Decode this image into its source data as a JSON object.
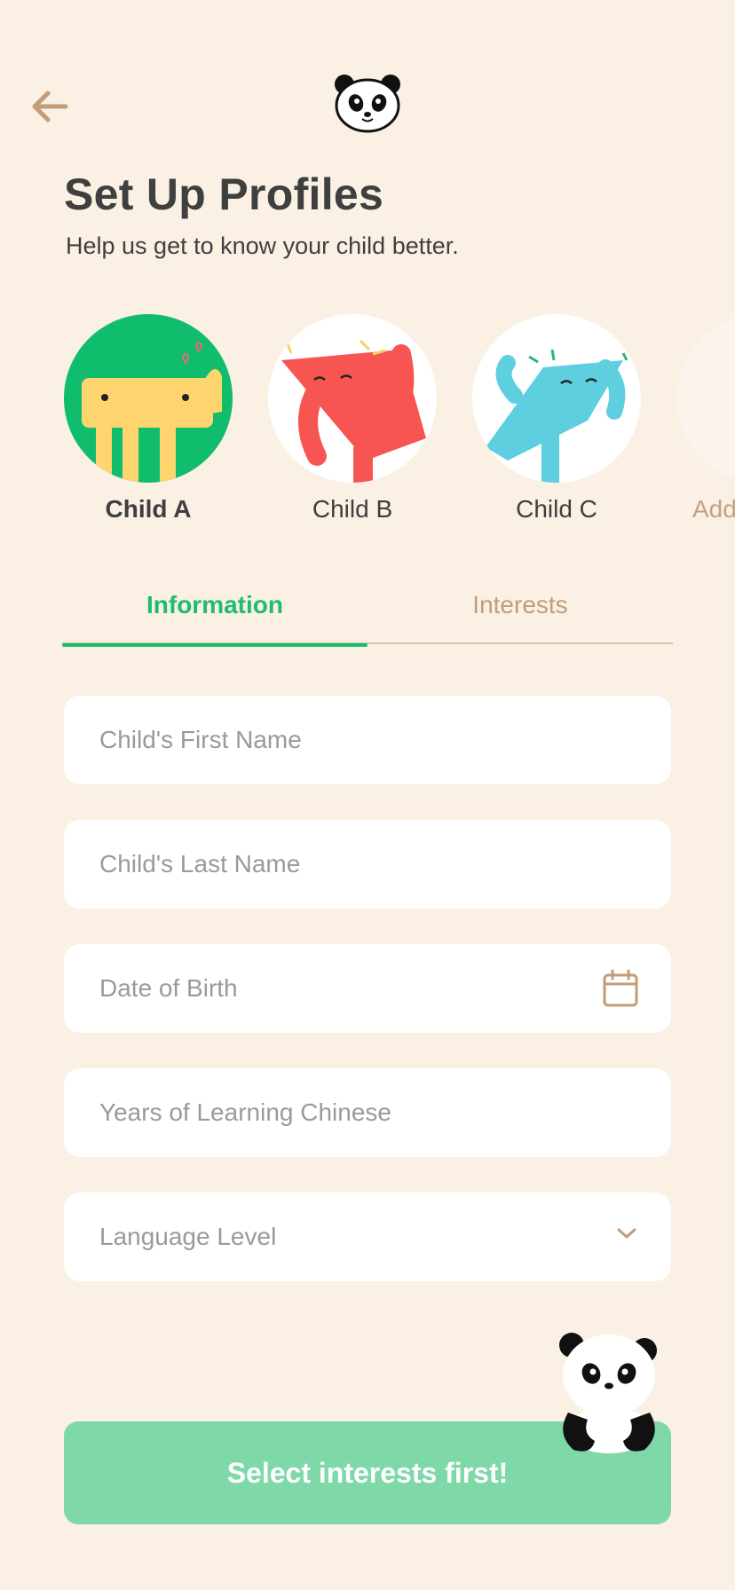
{
  "header": {
    "back_icon": "arrow-left-icon",
    "logo_icon": "panda-face-icon"
  },
  "page": {
    "title": "Set Up Profiles",
    "subtitle": "Help us get to know your child better."
  },
  "profiles": [
    {
      "name": "Child A",
      "selected": true,
      "avatar_icon": "yellow-creature-avatar",
      "bg": "#0fbd6d"
    },
    {
      "name": "Child B",
      "selected": false,
      "avatar_icon": "red-creature-avatar",
      "bg": "#ffffff"
    },
    {
      "name": "Child C",
      "selected": false,
      "avatar_icon": "blue-creature-avatar",
      "bg": "#ffffff"
    },
    {
      "name": "Add",
      "selected": false,
      "avatar_icon": "add-profile-avatar",
      "bg": "#fbf4ec"
    }
  ],
  "tabs": [
    {
      "label": "Information",
      "active": true
    },
    {
      "label": "Interests",
      "active": false
    }
  ],
  "form": {
    "first_name_placeholder": "Child's First Name",
    "last_name_placeholder": "Child's Last Name",
    "dob_placeholder": "Date of Birth",
    "dob_icon": "calendar-icon",
    "years_placeholder": "Years of Learning Chinese",
    "level_placeholder": "Language Level",
    "level_icon": "chevron-down-icon"
  },
  "footer": {
    "cta_label": "Select interests first!",
    "mascot_icon": "panda-mascot-icon"
  },
  "colors": {
    "background": "#faf0e4",
    "accent": "#1dbd6c",
    "accent_disabled": "#7ed8a8",
    "muted": "#c29d78"
  }
}
